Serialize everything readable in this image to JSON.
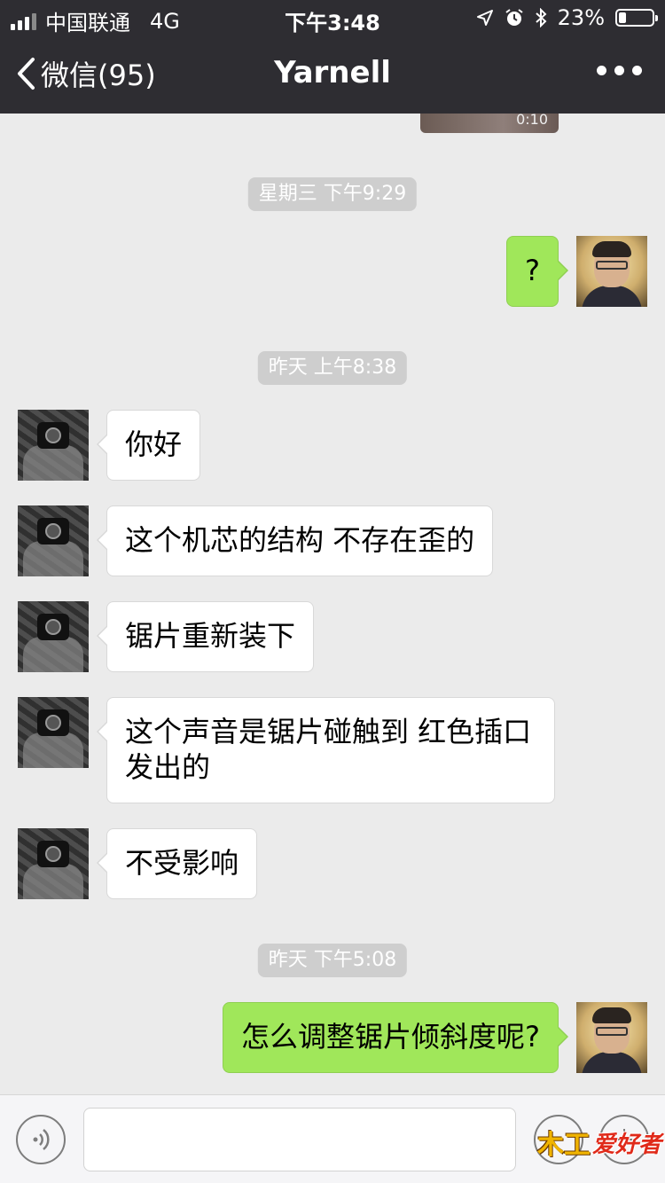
{
  "status_bar": {
    "carrier": "中国联通",
    "network": "4G",
    "time": "下午3:48",
    "battery": "23%",
    "battery_level": 0.23
  },
  "nav": {
    "back_label": "微信(95)",
    "title": "Yarnell"
  },
  "video": {
    "duration": "0:10"
  },
  "timestamps": [
    "星期三 下午9:29",
    "昨天 上午8:38",
    "昨天 下午5:08"
  ],
  "messages": [
    {
      "from": "me",
      "text": "?"
    },
    {
      "from": "other",
      "text": "你好"
    },
    {
      "from": "other",
      "text": "这个机芯的结构 不存在歪的"
    },
    {
      "from": "other",
      "text": "锯片重新装下"
    },
    {
      "from": "other",
      "text": "这个声音是锯片碰触到 红色插口发出的"
    },
    {
      "from": "other",
      "text": "不受影响"
    },
    {
      "from": "me",
      "text": "怎么调整锯片倾斜度呢?"
    }
  ],
  "watermark": {
    "part1": "木工",
    "part2": "爱好者"
  },
  "colors": {
    "nav_bg": "#2e2d32",
    "chat_bg": "#ebebeb",
    "my_bubble": "#a0e75a",
    "their_bubble": "#ffffff",
    "timestamp_bg": "#cecece"
  }
}
